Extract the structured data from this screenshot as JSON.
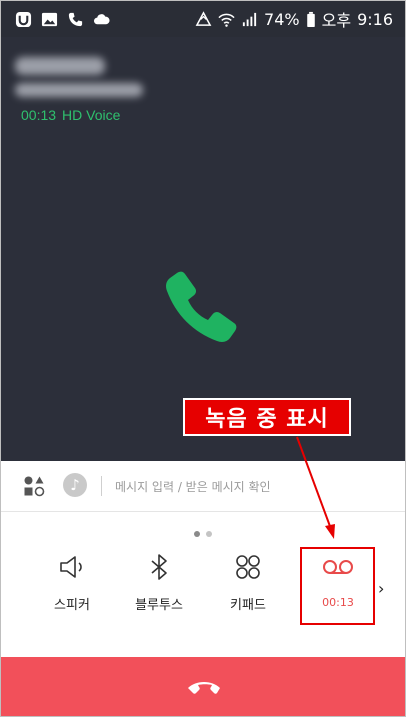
{
  "status_bar": {
    "battery": "74%",
    "ampm": "오후",
    "time": "9:16"
  },
  "call": {
    "duration": "00:13",
    "voice_quality": "HD Voice"
  },
  "annotation": {
    "label": "녹음 중 표시"
  },
  "message_bar": {
    "placeholder": "메시지 입력 / 받은 메시지 확인"
  },
  "controls": {
    "speaker_label": "스피커",
    "bluetooth_label": "블루투스",
    "keypad_label": "키패드",
    "record_time": "00:13"
  },
  "colors": {
    "call_bg": "#2c2f3a",
    "accent_green": "#2fc06e",
    "end_call": "#f2505a",
    "record_red": "#e84a4a",
    "annotation_red": "#e60000"
  }
}
